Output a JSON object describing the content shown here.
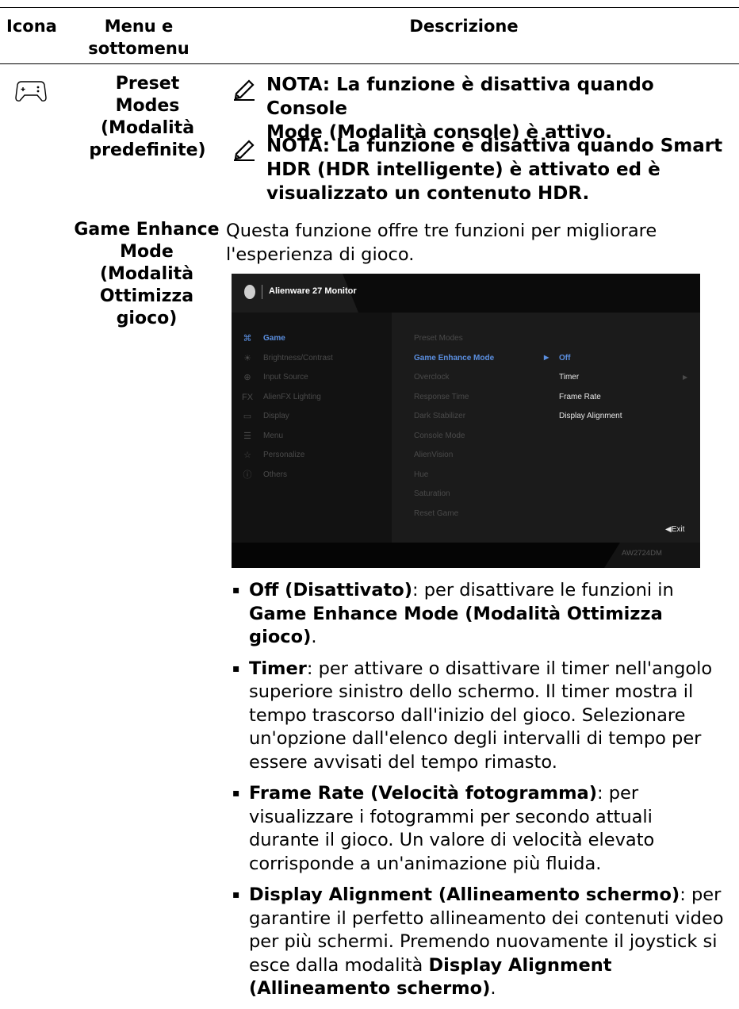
{
  "table_header": {
    "col_icon": "Icona",
    "col_menu_line1": "Menu e",
    "col_menu_line2": "sottomenu",
    "col_desc": "Descrizione"
  },
  "row_preset": {
    "menu_line1": "Preset Modes",
    "menu_line2": "(Modalità",
    "menu_line3": "predefinite)",
    "note1_line1": "NOTA: La funzione è disattiva quando Console",
    "note1_line2": "Mode (Modalità console) è attivo.",
    "note2_line1": "NOTA: La funzione è disattiva quando Smart",
    "note2_line2": "HDR (HDR intelligente) è attivato ed è",
    "note2_line3": "visualizzato un contenuto HDR."
  },
  "row_game_enhance": {
    "menu_line1": "Game Enhance",
    "menu_line2": "Mode",
    "menu_line3": "(Modalità",
    "menu_line4": "Ottimizza",
    "menu_line5": "gioco)",
    "intro_line1": "Questa funzione offre tre funzioni per migliorare",
    "intro_line2": "l'esperienza di gioco."
  },
  "osd": {
    "title": "Alienware 27 Monitor",
    "model": "AW2724DM",
    "exit_label": "◀Exit",
    "main_menu": [
      {
        "label": "Game",
        "icon": "gamepad-icon",
        "glyph": "🎮︎"
      },
      {
        "label": "Brightness/Contrast",
        "icon": "brightness-icon",
        "glyph": "☀"
      },
      {
        "label": "Input Source",
        "icon": "input-icon",
        "glyph": "⊕"
      },
      {
        "label": "AlienFX Lighting",
        "icon": "fx-icon",
        "glyph": "FX"
      },
      {
        "label": "Display",
        "icon": "display-icon",
        "glyph": "▭"
      },
      {
        "label": "Menu",
        "icon": "menu-icon",
        "glyph": "☰"
      },
      {
        "label": "Personalize",
        "icon": "star-icon",
        "glyph": "☆"
      },
      {
        "label": "Others",
        "icon": "info-icon",
        "glyph": "ⓘ"
      }
    ],
    "sub_menu": [
      "Preset Modes",
      "Game Enhance Mode",
      "Overclock",
      "Response Time",
      "Dark Stabilizer",
      "Console Mode",
      "AlienVision",
      "Hue",
      "Saturation",
      "Reset Game"
    ],
    "options": [
      {
        "label": "Off",
        "marker": "▶"
      },
      {
        "label": "Timer",
        "arrow": "▶"
      },
      {
        "label": "Frame Rate"
      },
      {
        "label": "Display Alignment"
      }
    ]
  },
  "bullets": {
    "off_bold": "Off (Disattivato)",
    "off_text": ": per disattivare le funzioni in",
    "off_bold2": "Game Enhance Mode (Modalità Ottimizza gioco)",
    "off_end": ".",
    "timer_bold": "Timer",
    "timer_text": ": per attivare o disattivare il timer nell'angolo superiore sinistro dello schermo. Il timer mostra il tempo trascorso dall'inizio del gioco. Selezionare un'opzione dall'elenco degli intervalli di tempo per essere avvisati del tempo rimasto.",
    "frame_bold": "Frame Rate (Velocità fotogramma)",
    "frame_text": ": per visualizzare i fotogrammi per secondo attuali durante il gioco. Un valore di velocità elevato corrisponde a un'animazione più fluida.",
    "align_bold": "Display Alignment (Allineamento schermo)",
    "align_text": ": per garantire il perfetto allineamento dei contenuti video per più schermi. Premendo nuovamente il joystick si esce dalla modalità",
    "align_bold2": "Display Alignment (Allineamento schermo)",
    "align_end": "."
  }
}
